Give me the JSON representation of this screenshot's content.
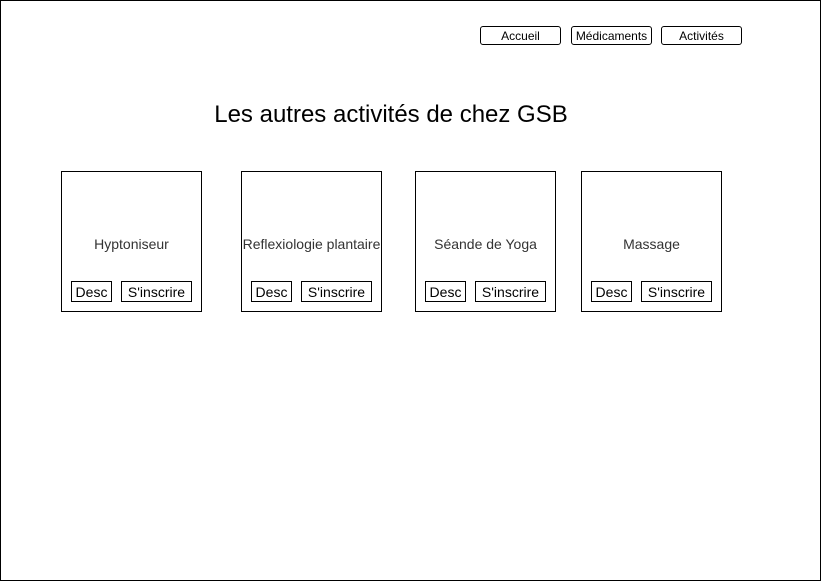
{
  "header": {
    "nav": [
      {
        "label": "Accueil"
      },
      {
        "label": "Médicaments"
      },
      {
        "label": "Activités"
      }
    ]
  },
  "main": {
    "title": "Les autres activités de chez GSB",
    "cards": [
      {
        "title": "Hyptoniseur",
        "desc_label": "Desc",
        "signup_label": "S'inscrire"
      },
      {
        "title": "Reflexiologie plantaire",
        "desc_label": "Desc",
        "signup_label": "S'inscrire"
      },
      {
        "title": "Séande de Yoga",
        "desc_label": "Desc",
        "signup_label": "S'inscrire"
      },
      {
        "title": "Massage",
        "desc_label": "Desc",
        "signup_label": "S'inscrire"
      }
    ]
  }
}
